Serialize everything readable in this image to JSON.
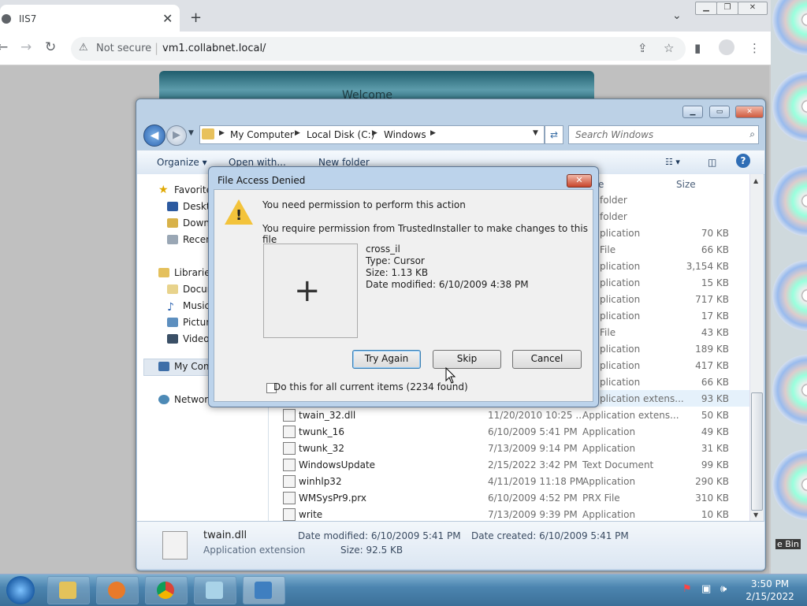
{
  "browser": {
    "tab_title": "IIS7",
    "tab_close": "✕",
    "new_tab": "+",
    "tab_dropdown": "⌄",
    "security": "Not secure",
    "url": "vm1.collabnet.local/",
    "page_heading": "Welcome"
  },
  "explorer": {
    "breadcrumbs": [
      "My Computer",
      "Local Disk (C:)",
      "Windows"
    ],
    "search_placeholder": "Search Windows",
    "commands": {
      "organize": "Organize ▾",
      "open_with": "Open with...",
      "new_folder": "New folder"
    },
    "column_size": "Size",
    "column_type_partial": "e",
    "nav": {
      "favorites": "Favorites",
      "desktop": "Desktop",
      "downloads": "Downloads",
      "recent": "Recent",
      "libraries": "Libraries",
      "documents": "Documents",
      "music": "Music",
      "pictures": "Pictures",
      "videos": "Videos",
      "my_computer": "My Com",
      "network": "Network"
    },
    "hidden_rows": [
      {
        "type": "folder",
        "size": ""
      },
      {
        "type": "folder",
        "size": ""
      },
      {
        "type": "plication",
        "size": "70 KB"
      },
      {
        "type": "File",
        "size": "66 KB"
      },
      {
        "type": "plication",
        "size": "3,154 KB"
      },
      {
        "type": "plication",
        "size": "15 KB"
      },
      {
        "type": "plication",
        "size": "717 KB"
      },
      {
        "type": "plication",
        "size": "17 KB"
      },
      {
        "type": "File",
        "size": "43 KB"
      },
      {
        "type": "plication",
        "size": "189 KB"
      },
      {
        "type": "plication",
        "size": "417 KB"
      },
      {
        "type": "plication",
        "size": "66 KB"
      },
      {
        "type": "plication extens...",
        "size": "93 KB"
      }
    ],
    "files": [
      {
        "name": "twain_32.dll",
        "date": "11/20/2010 10:25 ...",
        "type": "Application extens...",
        "size": "50 KB"
      },
      {
        "name": "twunk_16",
        "date": "6/10/2009 5:41 PM",
        "type": "Application",
        "size": "49 KB"
      },
      {
        "name": "twunk_32",
        "date": "7/13/2009 9:14 PM",
        "type": "Application",
        "size": "31 KB"
      },
      {
        "name": "WindowsUpdate",
        "date": "2/15/2022 3:42 PM",
        "type": "Text Document",
        "size": "99 KB"
      },
      {
        "name": "winhlp32",
        "date": "4/11/2019 11:18 PM",
        "type": "Application",
        "size": "290 KB"
      },
      {
        "name": "WMSysPr9.prx",
        "date": "6/10/2009 4:52 PM",
        "type": "PRX File",
        "size": "310 KB"
      },
      {
        "name": "write",
        "date": "7/13/2009 9:39 PM",
        "type": "Application",
        "size": "10 KB"
      }
    ],
    "details": {
      "name": "twain.dll",
      "kind": "Application extension",
      "modified": "Date modified: 6/10/2009 5:41 PM",
      "size": "Size: 92.5 KB",
      "created": "Date created: 6/10/2009 5:41 PM"
    }
  },
  "dialog": {
    "title": "File Access Denied",
    "close": "✕",
    "heading": "You need permission to perform this action",
    "message": "You require permission from TrustedInstaller to make changes to this file",
    "file_name": "cross_il",
    "file_type": "Type: Cursor",
    "file_size": "Size: 1.13 KB",
    "file_modified": "Date modified: 6/10/2009 4:38 PM",
    "buttons": {
      "try_again": "Try Again",
      "skip": "Skip",
      "cancel": "Cancel"
    },
    "checkbox_label": "Do this for all current items (2234 found)"
  },
  "desktop": {
    "recycle_bin_partial": "e Bin"
  },
  "taskbar": {
    "time": "3:50 PM",
    "date": "2/15/2022"
  }
}
